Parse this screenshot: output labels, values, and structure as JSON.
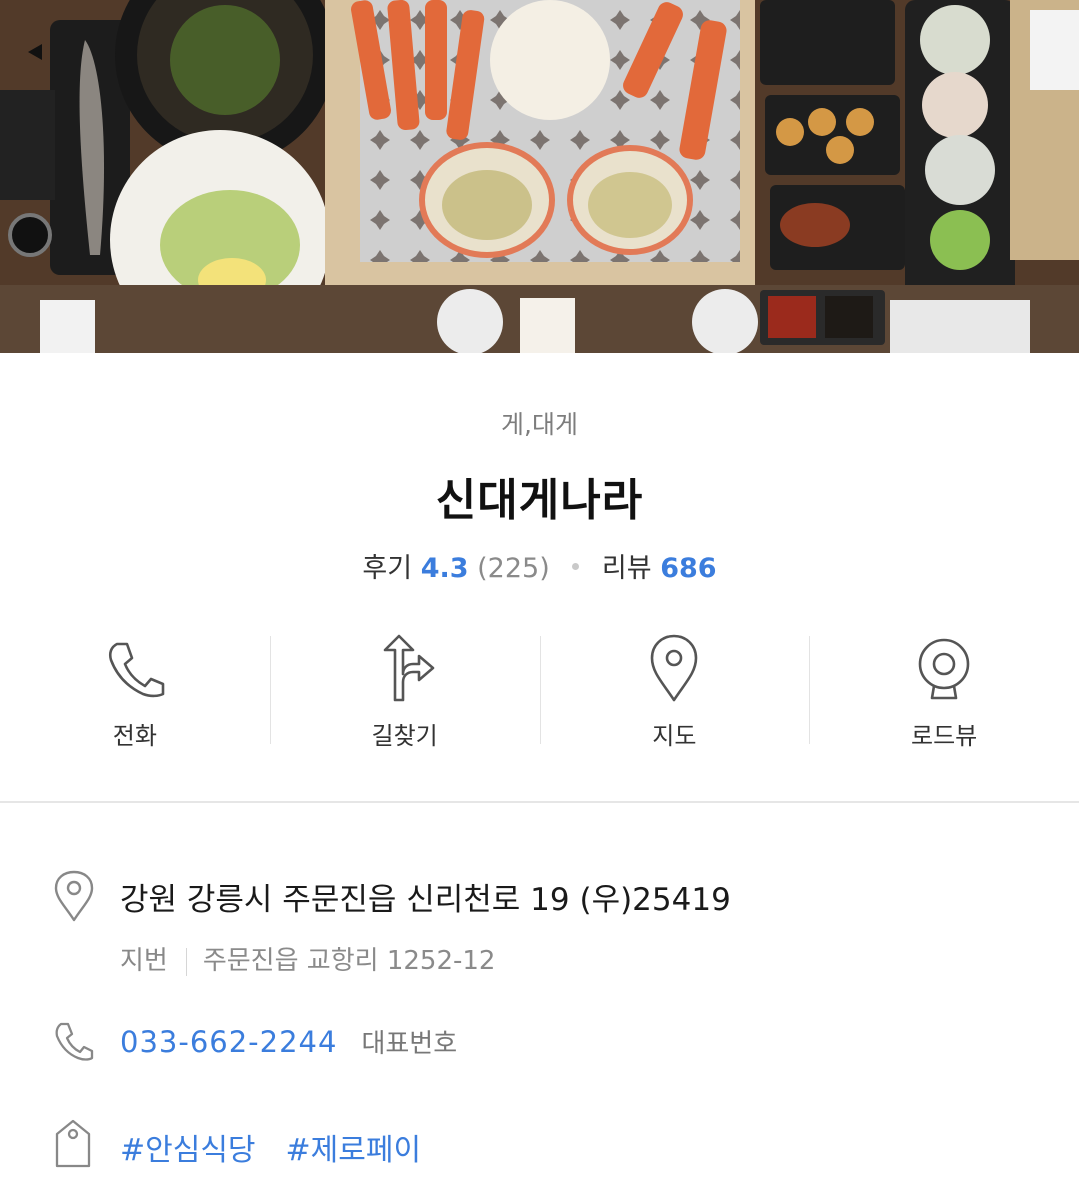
{
  "hero": {
    "image_description_icon": "photo-icon"
  },
  "place": {
    "category": "게,대게",
    "name": "신대게나라",
    "review_label": "후기",
    "review_score": "4.3",
    "review_count": "(225)",
    "blog_label": "리뷰",
    "blog_count": "686"
  },
  "actions": [
    {
      "label": "전화",
      "icon": "phone-icon"
    },
    {
      "label": "길찾기",
      "icon": "directions-icon"
    },
    {
      "label": "지도",
      "icon": "map-pin-icon"
    },
    {
      "label": "로드뷰",
      "icon": "roadview-camera-icon"
    }
  ],
  "info": {
    "address": "강원 강릉시 주문진읍 신리천로 19 (우)25419",
    "jibun_label": "지번",
    "jibun_value": "주문진읍 교항리 1252-12",
    "phone": "033-662-2244",
    "phone_tag": "대표번호",
    "tags": [
      "#안심식당",
      "#제로페이"
    ]
  },
  "colors": {
    "accent": "#3b7ddd",
    "text": "#222222",
    "muted": "#888888"
  }
}
